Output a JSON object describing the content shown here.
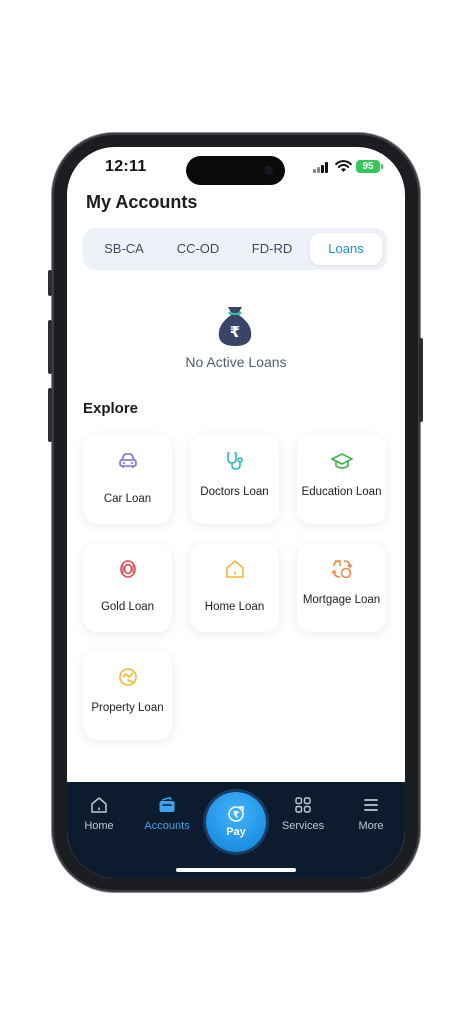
{
  "status_bar": {
    "time": "12:11",
    "battery": "95"
  },
  "header": {
    "title": "My Accounts"
  },
  "tabs": [
    {
      "label": "SB-CA",
      "active": false
    },
    {
      "label": "CC-OD",
      "active": false
    },
    {
      "label": "FD-RD",
      "active": false
    },
    {
      "label": "Loans",
      "active": true
    }
  ],
  "empty_state": {
    "icon": "money-bag-rupee-icon",
    "text": "No Active Loans"
  },
  "explore": {
    "heading": "Explore",
    "items": [
      {
        "label": "Car Loan",
        "icon": "car-icon",
        "color": "#7b6fd6"
      },
      {
        "label": "Doctors Loan",
        "icon": "stethoscope-icon",
        "color": "#2bb5c9"
      },
      {
        "label": "Education Loan",
        "icon": "graduation-cap-icon",
        "color": "#3bb54a"
      },
      {
        "label": "Gold Loan",
        "icon": "gold-coin-icon",
        "color": "#e0474c"
      },
      {
        "label": "Home Loan",
        "icon": "house-icon",
        "color": "#f1b733"
      },
      {
        "label": "Mortgage Loan",
        "icon": "exchange-icon",
        "color": "#f08a4b"
      },
      {
        "label": "Property Loan",
        "icon": "property-icon",
        "color": "#f1b733"
      }
    ]
  },
  "bottom_nav": {
    "items": [
      {
        "label": "Home",
        "icon": "home-icon",
        "active": false
      },
      {
        "label": "Accounts",
        "icon": "wallet-icon",
        "active": true
      },
      {
        "label": "Services",
        "icon": "grid-icon",
        "active": false
      },
      {
        "label": "More",
        "icon": "menu-icon",
        "active": false
      }
    ],
    "pay": {
      "label": "Pay",
      "icon": "pay-rupee-icon"
    }
  },
  "colors": {
    "accent": "#1c8fd6",
    "nav_bg": "#0d1b2e",
    "pay": "#2a9df4"
  }
}
